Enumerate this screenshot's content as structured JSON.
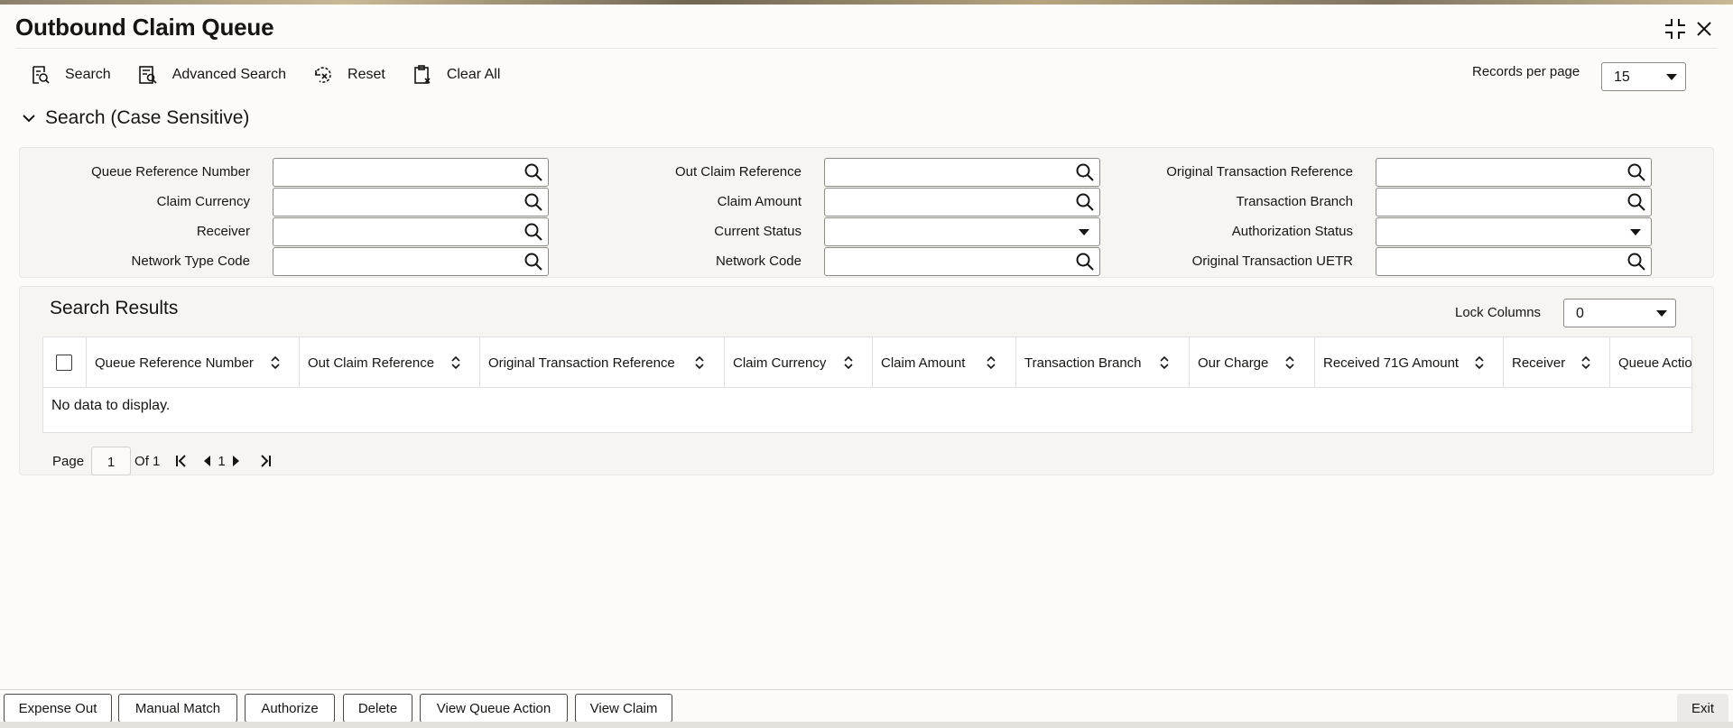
{
  "window": {
    "title": "Outbound Claim Queue"
  },
  "toolbar": {
    "search": "Search",
    "advanced_search": "Advanced Search",
    "reset": "Reset",
    "clear_all": "Clear All"
  },
  "records_per_page": {
    "label": "Records per page",
    "value": "15"
  },
  "search_section": {
    "title": "Search (Case Sensitive)",
    "fields": {
      "queue_reference_number": {
        "label": "Queue Reference Number",
        "value": "",
        "type": "lookup"
      },
      "out_claim_reference": {
        "label": "Out Claim Reference",
        "value": "",
        "type": "lookup"
      },
      "original_transaction_reference": {
        "label": "Original Transaction Reference",
        "value": "",
        "type": "lookup"
      },
      "claim_currency": {
        "label": "Claim Currency",
        "value": "",
        "type": "lookup"
      },
      "claim_amount": {
        "label": "Claim Amount",
        "value": "",
        "type": "lookup"
      },
      "transaction_branch": {
        "label": "Transaction Branch",
        "value": "",
        "type": "lookup"
      },
      "receiver": {
        "label": "Receiver",
        "value": "",
        "type": "lookup"
      },
      "current_status": {
        "label": "Current Status",
        "value": "",
        "type": "select"
      },
      "authorization_status": {
        "label": "Authorization Status",
        "value": "",
        "type": "select"
      },
      "network_type_code": {
        "label": "Network Type Code",
        "value": "",
        "type": "lookup"
      },
      "network_code": {
        "label": "Network Code",
        "value": "",
        "type": "lookup"
      },
      "original_transaction_uetr": {
        "label": "Original Transaction UETR",
        "value": "",
        "type": "lookup"
      }
    }
  },
  "results": {
    "title": "Search Results",
    "lock_columns": {
      "label": "Lock Columns",
      "value": "0"
    },
    "columns": [
      "Queue Reference Number",
      "Out Claim Reference",
      "Original Transaction Reference",
      "Claim Currency",
      "Claim Amount",
      "Transaction Branch",
      "Our Charge",
      "Received 71G Amount",
      "Receiver",
      "Queue Actio"
    ],
    "empty_message": "No data to display."
  },
  "pagination": {
    "page_label": "Page",
    "page_value": "1",
    "of_label": "Of 1",
    "current": "1"
  },
  "footer": {
    "buttons": [
      "Expense Out",
      "Manual Match",
      "Authorize",
      "Delete",
      "View Queue Action",
      "View Claim"
    ],
    "exit": "Exit"
  },
  "icons": {
    "restore": "collapse-arrows-icon",
    "close": "close-icon",
    "search": "search-list-icon",
    "advanced_search": "advanced-search-icon",
    "reset": "reset-icon",
    "clear_all": "clear-all-icon",
    "lookup": "magnifier-icon",
    "sort": "sort-icon"
  }
}
